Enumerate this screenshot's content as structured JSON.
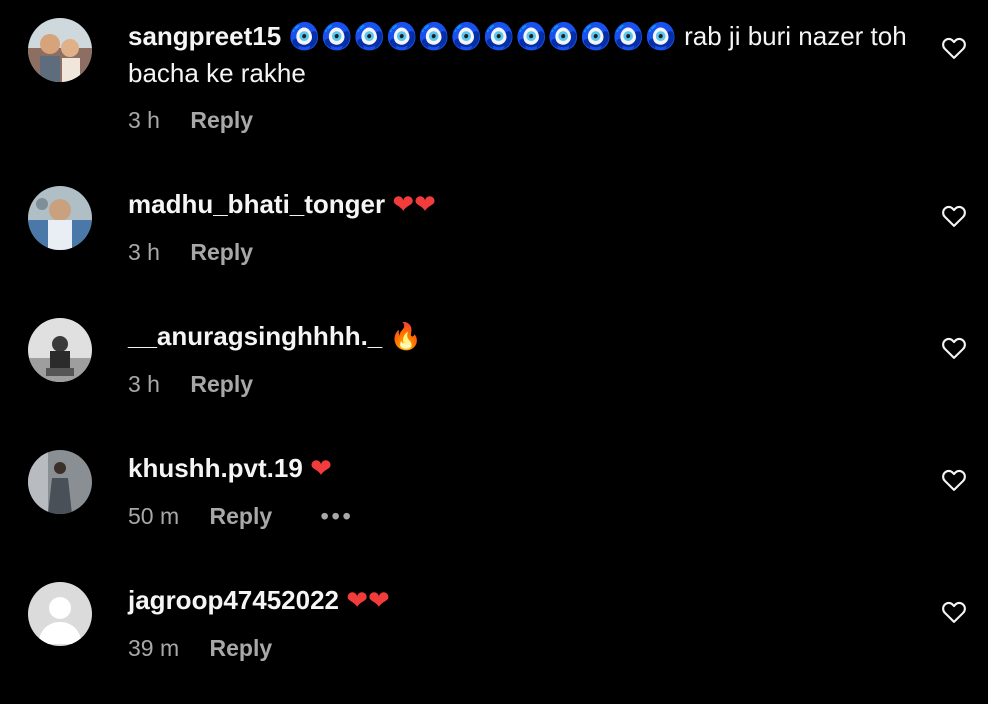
{
  "comments": [
    {
      "username": "sangpreet15",
      "emoji": "🧿🧿🧿🧿🧿🧿🧿🧿🧿🧿🧿🧿",
      "text": " rab ji buri nazer toh bacha ke rakhe",
      "time": "3 h",
      "reply_label": "Reply",
      "avatar_icon": "user-photo"
    },
    {
      "username": "madhu_bhati_tonger",
      "emoji": "❤❤",
      "text": "",
      "time": "3 h",
      "reply_label": "Reply",
      "avatar_icon": "user-photo"
    },
    {
      "username": "__anuragsinghhhh._",
      "emoji": "🔥",
      "text": "",
      "time": "3 h",
      "reply_label": "Reply",
      "avatar_icon": "user-photo"
    },
    {
      "username": "khushh.pvt.19",
      "emoji": "❤",
      "text": "",
      "time": "50 m",
      "reply_label": "Reply",
      "more_label": "•••",
      "avatar_icon": "user-photo"
    },
    {
      "username": "jagroop47452022",
      "emoji": "❤❤",
      "text": "",
      "time": "39 m",
      "reply_label": "Reply",
      "avatar_icon": "default-avatar"
    }
  ],
  "colors": {
    "background": "#000000",
    "text_primary": "#f5f5f5",
    "text_secondary": "#a8a8a8",
    "heart_emoji": "#f23b3b",
    "nazar_emoji": "#2f64e8"
  },
  "icons": {
    "like": "heart-outline-icon"
  }
}
